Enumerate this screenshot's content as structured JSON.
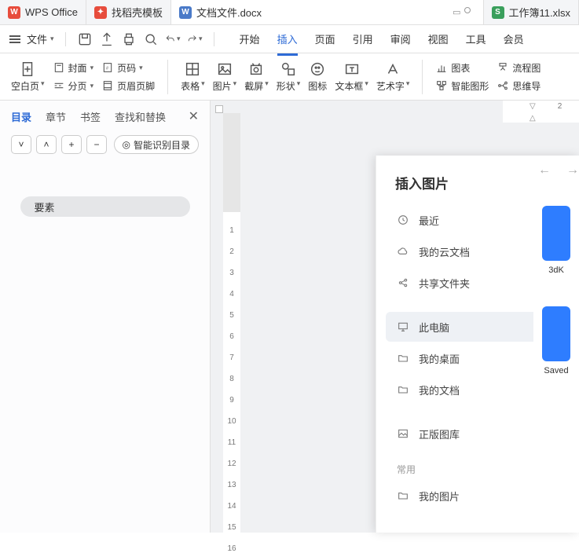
{
  "tabs": {
    "app": "WPS Office",
    "t1": "找稻壳模板",
    "t2": "文档文件.docx",
    "t3": "工作簿11.xlsx"
  },
  "menu": {
    "file": "文件",
    "items": [
      "开始",
      "插入",
      "页面",
      "引用",
      "审阅",
      "视图",
      "工具",
      "会员"
    ],
    "activeIndex": 1
  },
  "ribbon": {
    "blank": "空白页",
    "cover": "封面",
    "pagenum": "页码",
    "break": "分页",
    "headerfooter": "页眉页脚",
    "table": "表格",
    "picture": "图片",
    "screenshot": "截屏",
    "shape": "形状",
    "icon": "图标",
    "textbox": "文本框",
    "wordart": "艺术字",
    "chart": "图表",
    "smartart": "智能图形",
    "flow": "流程图",
    "mind": "思维导"
  },
  "side": {
    "tabs": [
      "目录",
      "章节",
      "书签",
      "查找和替换"
    ],
    "activeIndex": 0,
    "recognize": "智能识别目录",
    "toc0": "要素"
  },
  "hruler": {
    "v0": "2"
  },
  "vruler": [
    "1",
    "2",
    "3",
    "4",
    "5",
    "6",
    "7",
    "8",
    "9",
    "10",
    "11",
    "12",
    "13",
    "14",
    "15",
    "16"
  ],
  "modal": {
    "title": "插入图片",
    "recent": "最近",
    "cloud": "我的云文档",
    "shared": "共享文件夹",
    "thispc": "此电脑",
    "desktop": "我的桌面",
    "mydocs": "我的文档",
    "stock": "正版图库",
    "commonLabel": "常用",
    "mypics": "我的图片"
  },
  "rpanel": {
    "l1": "3dK",
    "l2": "Saved"
  }
}
